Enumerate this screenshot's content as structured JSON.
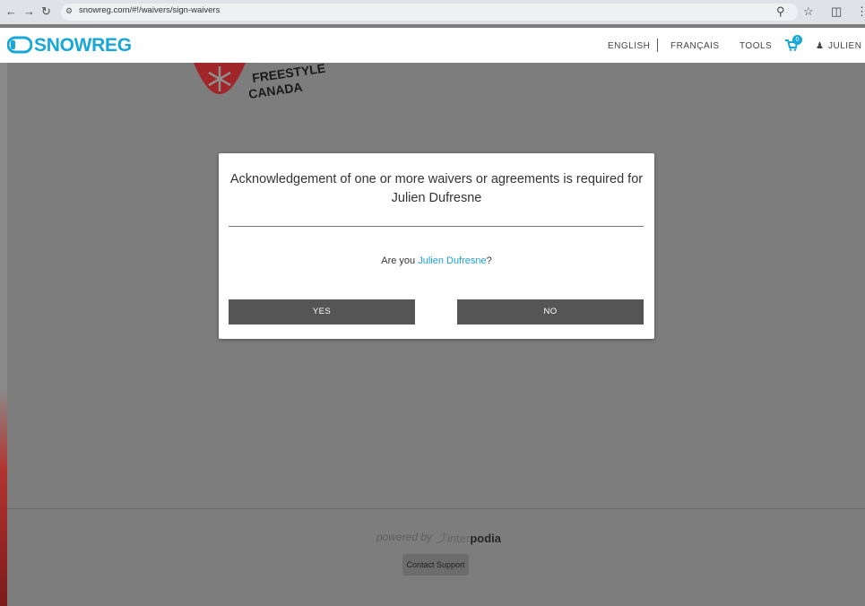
{
  "browser": {
    "url": "snowreg.com/#!/waivers/sign-waivers",
    "back_icon": "arrow-left",
    "forward_icon": "arrow-right",
    "reload_icon": "reload"
  },
  "header": {
    "logo_text": "SNOWREG",
    "links": [
      "ENGLISH",
      "FRANÇAIS",
      "TOOLS"
    ],
    "cart_count": "0",
    "user_label": "JULIEN",
    "brand_color": "#18a7d9"
  },
  "partner_logo": {
    "text_line1": "FREESTYLE",
    "text_line2": "CANADA"
  },
  "modal": {
    "title": "Acknowledgement of one or more waivers or agreements is required for Julien Dufresne",
    "question_prefix": "Are you ",
    "question_name": "Julien Dufresne",
    "question_suffix": "?",
    "yes_label": "YES",
    "no_label": "NO"
  },
  "footer": {
    "powered_by": "powered by",
    "brand_light": "inter",
    "brand_bold": "podia",
    "support_label": "Contact Support"
  }
}
